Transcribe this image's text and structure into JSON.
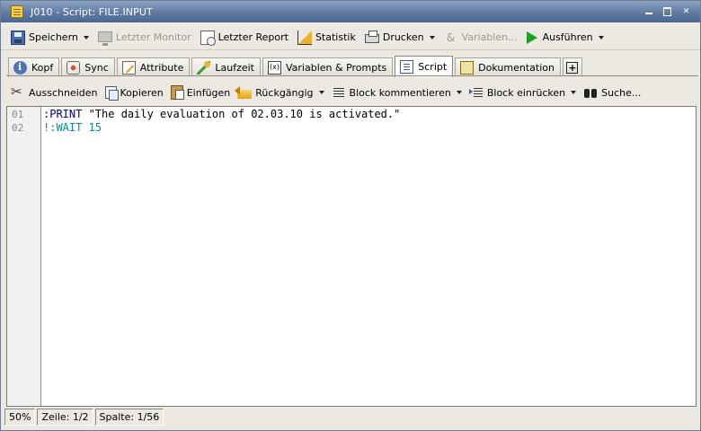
{
  "window": {
    "title": "J010 - Script: FILE.INPUT"
  },
  "toolbar": {
    "items": [
      {
        "label": "Speichern",
        "icon": "save-icon",
        "dropdown": true,
        "enabled": true
      },
      {
        "label": "Letzter Monitor",
        "icon": "monitor-icon",
        "dropdown": false,
        "enabled": false
      },
      {
        "label": "Letzter Report",
        "icon": "report-icon",
        "dropdown": false,
        "enabled": true
      },
      {
        "label": "Statistik",
        "icon": "statistics-icon",
        "dropdown": false,
        "enabled": true
      },
      {
        "label": "Drucken",
        "icon": "print-icon",
        "dropdown": true,
        "enabled": true
      },
      {
        "label": "Variablen...",
        "icon": "variables-icon",
        "dropdown": false,
        "enabled": false
      },
      {
        "label": "Ausführen",
        "icon": "run-icon",
        "dropdown": true,
        "enabled": true
      }
    ]
  },
  "tabs": [
    {
      "label": "Kopf",
      "icon": "info-icon",
      "active": false
    },
    {
      "label": "Sync",
      "icon": "sync-icon",
      "active": false
    },
    {
      "label": "Attribute",
      "icon": "attribute-icon",
      "active": false
    },
    {
      "label": "Laufzeit",
      "icon": "runtime-icon",
      "active": false
    },
    {
      "label": "Variablen & Prompts",
      "icon": "variables-prompts-icon",
      "active": false
    },
    {
      "label": "Script",
      "icon": "script-icon",
      "active": true
    },
    {
      "label": "Dokumentation",
      "icon": "documentation-icon",
      "active": false
    }
  ],
  "add_tab_label": "+",
  "edit_toolbar": {
    "items": [
      {
        "label": "Ausschneiden",
        "icon": "cut-icon",
        "dropdown": false
      },
      {
        "label": "Kopieren",
        "icon": "copy-icon",
        "dropdown": false
      },
      {
        "label": "Einfügen",
        "icon": "paste-icon",
        "dropdown": false
      },
      {
        "label": "Rückgängig",
        "icon": "undo-icon",
        "dropdown": true
      },
      {
        "label": "Block kommentieren",
        "icon": "comment-block-icon",
        "dropdown": true
      },
      {
        "label": "Block einrücken",
        "icon": "indent-block-icon",
        "dropdown": true
      },
      {
        "label": "Suche...",
        "icon": "binoculars-icon",
        "dropdown": false
      }
    ]
  },
  "editor": {
    "line_numbers": [
      "01",
      "02"
    ],
    "lines": [
      {
        "keyword": ":PRINT ",
        "string": "\"The daily evaluation of 02.03.10 is activated.\"",
        "color": "#000080"
      },
      {
        "keyword": "!:WAIT 15",
        "string": "",
        "color": "#009090"
      }
    ]
  },
  "statusbar": {
    "zoom": "50%",
    "line": "Zeile: 1/2",
    "column": "Spalte: 1/56"
  },
  "colors": {
    "titlebar": "#5f7aa3",
    "run_accent": "#20a020",
    "keyword": "#000080",
    "comment": "#009090"
  }
}
